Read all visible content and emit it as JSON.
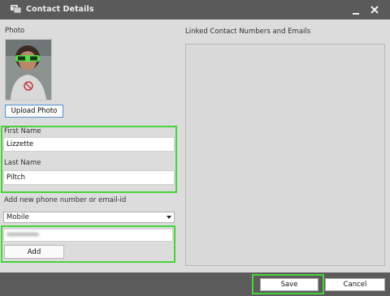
{
  "window": {
    "title": "Contact Details",
    "icon": "contact-card-icon",
    "controls": {
      "minimize_icon": "minimize-icon",
      "close_icon": "close-icon"
    }
  },
  "photo_section": {
    "label": "Photo",
    "upload_button": "Upload Photo"
  },
  "first_name": {
    "label": "First Name",
    "value": "Lizzette"
  },
  "last_name": {
    "label": "Last Name",
    "value": "Piltch"
  },
  "add_contact": {
    "label": "Add new phone number or email-id",
    "type_select": {
      "selected": "Mobile"
    },
    "add_button": "Add"
  },
  "linked": {
    "label": "Linked Contact Numbers and Emails",
    "items": []
  },
  "footer": {
    "save_label": "Save",
    "cancel_label": "Cancel"
  },
  "colors": {
    "highlight": "#49d23b",
    "titlebar": "#5a5a5a",
    "footer": "#5c5c5c",
    "upload_border": "#4f8fd6"
  }
}
